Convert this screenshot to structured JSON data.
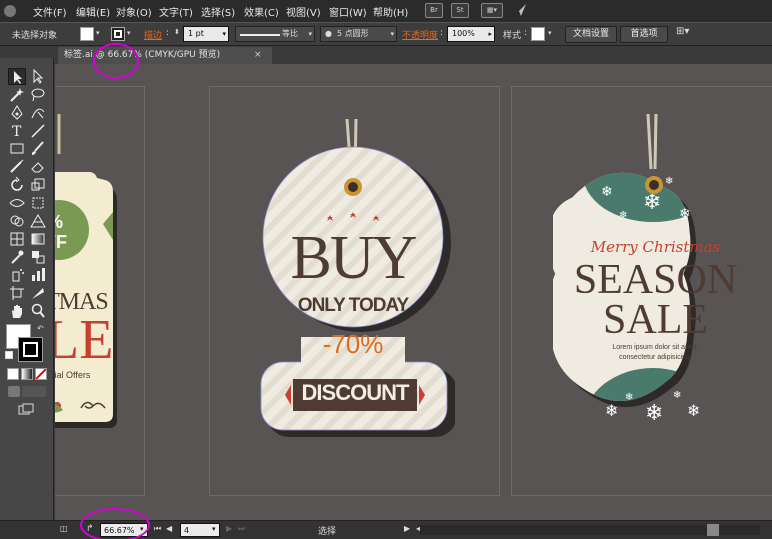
{
  "menu": [
    "文件(F)",
    "编辑(E)",
    "对象(O)",
    "文字(T)",
    "选择(S)",
    "效果(C)",
    "视图(V)",
    "窗口(W)",
    "帮助(H)"
  ],
  "app_icons": [
    "Br",
    "St"
  ],
  "control": {
    "selection_label": "未选择对象",
    "stroke_label": "描边",
    "stroke_value": "1 pt",
    "profile_label": "等比",
    "brush_label": "5 点圆形",
    "opacity_label": "不透明度",
    "opacity_value": "100%",
    "style_label": "样式",
    "doc_settings_button": "文档设置",
    "preferences_button": "首选项"
  },
  "doc_tab": {
    "title": "标签.ai @ 66.67% (CMYK/GPU 预览)",
    "close": "×"
  },
  "status": {
    "zoom": "66.67%",
    "page": "4",
    "mode": "选择"
  },
  "tag1": {
    "badge_line1": "%",
    "badge_line2": "FF",
    "word1": "TMAS",
    "word2": "LE",
    "subtitle": "ecial Offers"
  },
  "tag2": {
    "line1": "BUY",
    "line2": "ONLY TODAY",
    "percent": "-70%",
    "banner": "DISCOUNT"
  },
  "tag3": {
    "script": "Merry Christmas",
    "line1": "SEASON",
    "line2": "SALE",
    "small1": "Lorem ipsum dolor sit amet,",
    "small2": "consectetur adipisicing."
  },
  "colors": {
    "accent_orange": "#e06a1e",
    "tag_brown": "#4e3b32",
    "tag_red": "#c8402e",
    "tag_teal": "#4a7a6c",
    "tag_cream": "#f2eee3",
    "highlight": "#d600d6"
  }
}
